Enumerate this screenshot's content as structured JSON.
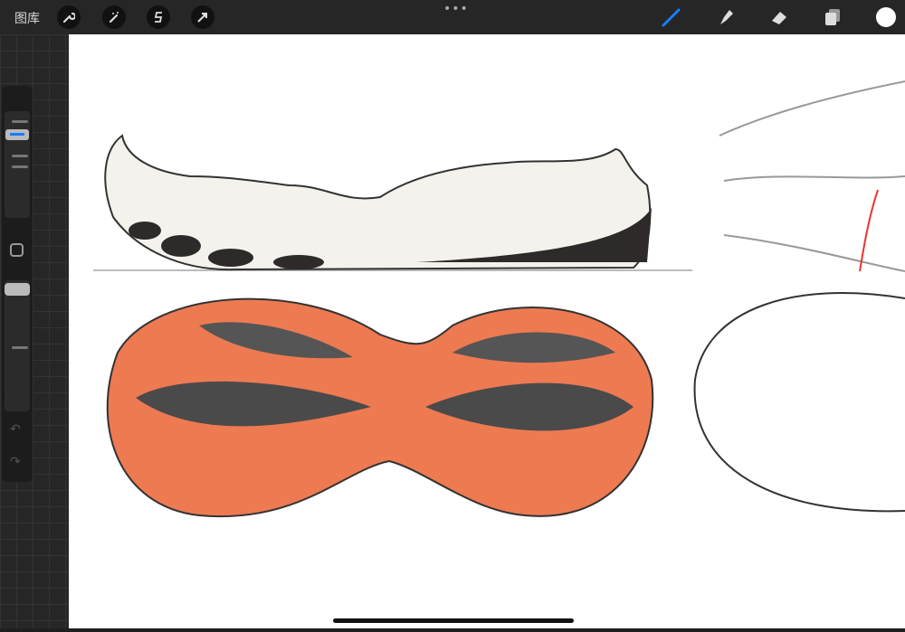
{
  "topbar": {
    "gallery_label": "图库",
    "more_label": "•••",
    "left_tools": [
      "wrench-icon",
      "magic-wand-icon",
      "selection-icon",
      "transform-arrow-icon"
    ],
    "right_tools": [
      "brush-icon",
      "smudge-icon",
      "eraser-icon",
      "layers-icon",
      "color-swatch"
    ],
    "accent": "#1a7cff",
    "current_color": "#ffffff"
  },
  "sidebar": {
    "brush_size": 0.8,
    "opacity": 1.0,
    "controls": [
      "modify-button",
      "undo-icon",
      "redo-icon"
    ]
  }
}
